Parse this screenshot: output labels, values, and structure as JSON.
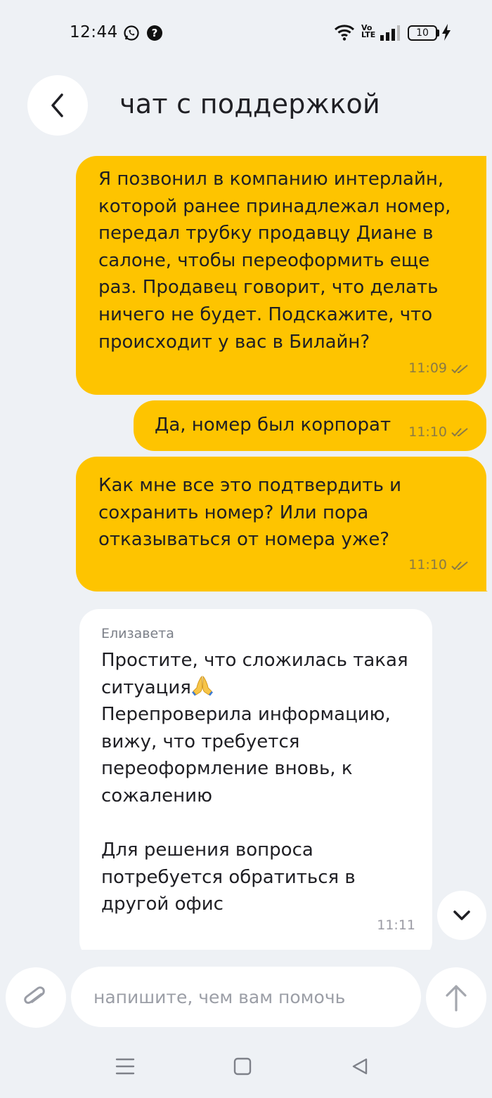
{
  "status_bar": {
    "time": "12:44",
    "battery": "10",
    "network": "Vo LTE",
    "icons": [
      "whatsapp-icon",
      "help-icon",
      "wifi-icon",
      "volte-icon",
      "signal-icon",
      "battery-icon",
      "charging-icon"
    ]
  },
  "header": {
    "title": "чат с поддержкой",
    "back_icon": "chevron-left-icon"
  },
  "messages": [
    {
      "direction": "out",
      "text": "Я позвонил в компанию интерлайн, которой ранее принадлежал номер, передал трубку продавцу Диане в салоне, чтобы переоформить еще раз. Продавец говорит, что делать ничего не будет. Подскажите, что происходит у вас в Билайн?",
      "time": "11:09",
      "status": "read"
    },
    {
      "direction": "out",
      "text": "Да, номер был корпорат",
      "time": "11:10",
      "status": "read"
    },
    {
      "direction": "out",
      "text": "Как мне все это подтвердить и сохранить номер? Или пора отказываться от номера уже?",
      "time": "11:10",
      "status": "read"
    },
    {
      "direction": "in",
      "sender": "Елизавета",
      "text_part1": "Простите, что сложилась такая ситуация",
      "emoji": "folded-hands-emoji",
      "text_part2": "Перепроверила информацию, вижу, что требуется переоформление вновь, к сожалению\n\nДля решения вопроса потребуется обратиться в другой офис",
      "time": "11:11"
    }
  ],
  "composer": {
    "placeholder": "напишите, чем вам помочь",
    "value": "",
    "attach_icon": "paperclip-icon",
    "send_icon": "arrow-up-icon"
  },
  "scroll_button_icon": "chevron-down-icon",
  "nav_bar": [
    "menu-icon",
    "home-icon",
    "back-triangle-icon"
  ],
  "colors": {
    "background": "#eef1f5",
    "outgoing_bubble": "#fec400",
    "incoming_bubble": "#ffffff",
    "text": "#1f1f24"
  }
}
